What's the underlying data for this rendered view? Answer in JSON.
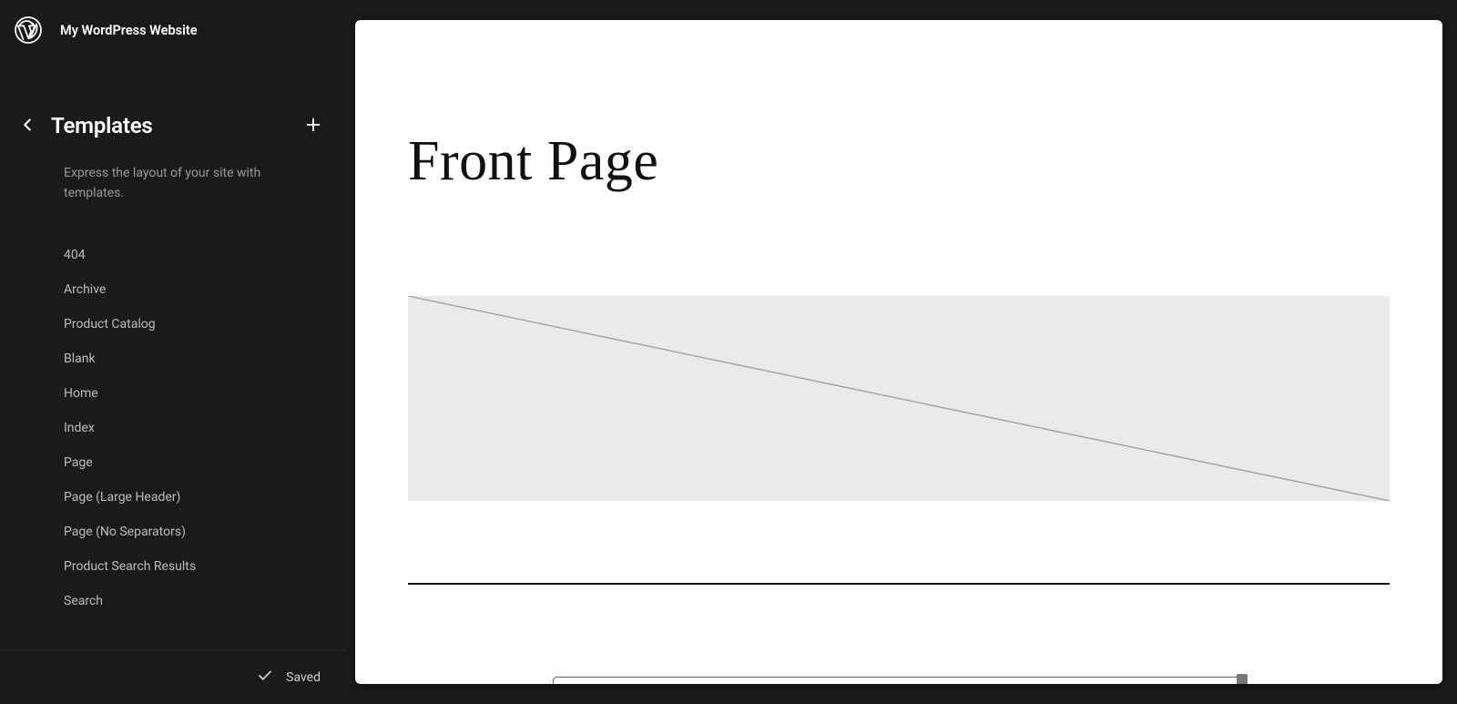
{
  "header": {
    "site_name": "My WordPress Website"
  },
  "sidebar": {
    "title": "Templates",
    "description": "Express the layout of your site with templates.",
    "items": [
      {
        "label": "404"
      },
      {
        "label": "Archive"
      },
      {
        "label": "Product Catalog"
      },
      {
        "label": "Blank"
      },
      {
        "label": "Home"
      },
      {
        "label": "Index"
      },
      {
        "label": "Page"
      },
      {
        "label": "Page (Large Header)"
      },
      {
        "label": "Page (No Separators)"
      },
      {
        "label": "Product Search Results"
      },
      {
        "label": "Search"
      }
    ],
    "status": "Saved"
  },
  "canvas": {
    "page_title": "Front Page"
  },
  "icons": {
    "wp_logo": "wordpress-logo",
    "back": "chevron-left-icon",
    "add": "plus-icon",
    "check": "check-icon"
  }
}
